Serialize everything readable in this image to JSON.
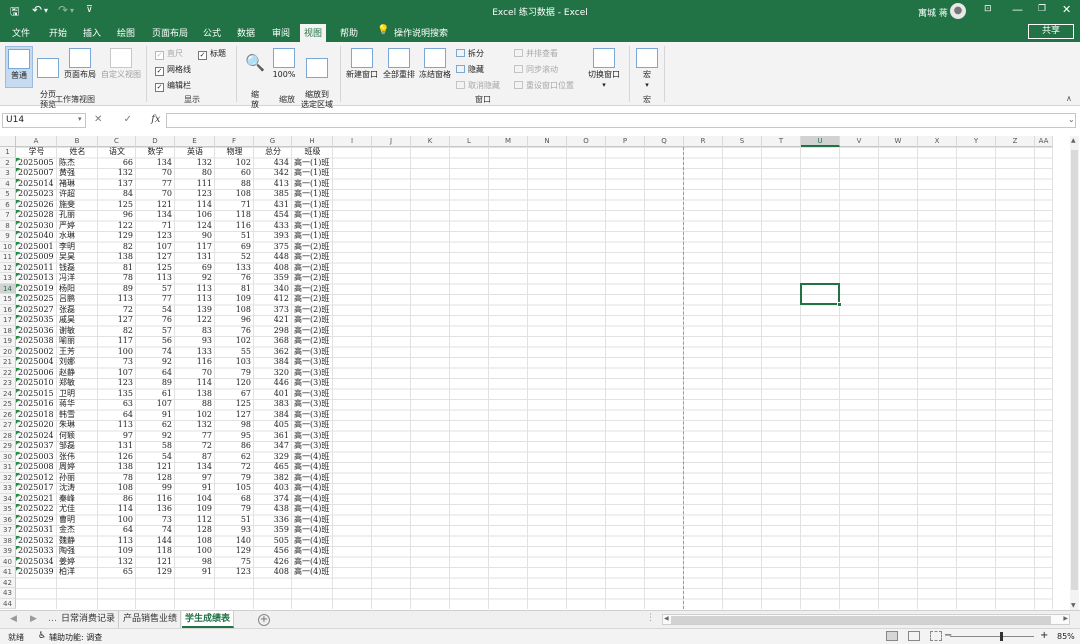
{
  "title_bar": {
    "save_icon": "save-icon",
    "undo_icon": "undo-icon",
    "redo_icon": "redo-icon",
    "customize_icon": "dropdown-icon",
    "doc_title": "Excel 练习数据 - Excel",
    "user_name": "寓城 蒋",
    "avatar_icon": "user-avatar-icon"
  },
  "menu": {
    "tabs": [
      "文件",
      "开始",
      "插入",
      "绘图",
      "页面布局",
      "公式",
      "数据",
      "审阅",
      "视图",
      "帮助",
      "操作说明搜索"
    ],
    "active": "视图",
    "search_icon": "lightbulb-icon",
    "share": "共享"
  },
  "ribbon": {
    "workbook_views": {
      "label": "工作簿视图",
      "normal": "普通",
      "page_break": "分页\n预览",
      "page_layout": "页面布局",
      "custom": "自定义视图"
    },
    "show": {
      "label": "显示",
      "ruler": "直尺",
      "gridlines": "网格线",
      "formula_bar": "编辑栏",
      "headings": "标题"
    },
    "zoom": {
      "label": "缩放",
      "zoom": "缩\n放",
      "100": "100%",
      "zoom_selection": "缩放到\n选定区域"
    },
    "window": {
      "label": "窗口",
      "new_window": "新建窗口",
      "arrange_all": "全部重排",
      "freeze": "冻结窗格",
      "split": "拆分",
      "hide": "隐藏",
      "unhide": "取消隐藏",
      "side_by_side": "并排查看",
      "sync_scroll": "同步滚动",
      "reset_position": "重设窗口位置",
      "switch": "切换窗口"
    },
    "macros": {
      "label": "宏",
      "macros": "宏"
    }
  },
  "formula_bar": {
    "name_box": "U14",
    "cancel": "✕",
    "enter": "✓",
    "fx": "fx",
    "value": ""
  },
  "grid": {
    "columns": [
      "A",
      "B",
      "C",
      "D",
      "E",
      "F",
      "G",
      "H",
      "I",
      "J",
      "K",
      "L",
      "M",
      "N",
      "O",
      "P",
      "Q",
      "R",
      "S",
      "T",
      "U",
      "V",
      "W",
      "X",
      "Y",
      "Z",
      "AA"
    ],
    "selected_col": "U",
    "selected_row": 14,
    "row_numbers": [
      1,
      2,
      3,
      4,
      5,
      6,
      7,
      8,
      9,
      10,
      11,
      12,
      13,
      14,
      15,
      16,
      17,
      18,
      19,
      20,
      21,
      22,
      23,
      24,
      25,
      26,
      27,
      28,
      29,
      30,
      31,
      32,
      33,
      34,
      35,
      36,
      37,
      38,
      39,
      40,
      41,
      42,
      43,
      44
    ],
    "header": [
      "学号",
      "姓名",
      "语文",
      "数学",
      "英语",
      "物理",
      "总分",
      "班级"
    ],
    "rows": [
      [
        "2025005",
        "陈杰",
        "66",
        "134",
        "132",
        "102",
        "434",
        "高一(1)班"
      ],
      [
        "2025007",
        "黄强",
        "132",
        "70",
        "80",
        "60",
        "342",
        "高一(1)班"
      ],
      [
        "2025014",
        "褚琳",
        "137",
        "77",
        "111",
        "88",
        "413",
        "高一(1)班"
      ],
      [
        "2025023",
        "许超",
        "84",
        "70",
        "123",
        "108",
        "385",
        "高一(1)班"
      ],
      [
        "2025026",
        "施斐",
        "125",
        "121",
        "114",
        "71",
        "431",
        "高一(1)班"
      ],
      [
        "2025028",
        "孔丽",
        "96",
        "134",
        "106",
        "118",
        "454",
        "高一(1)班"
      ],
      [
        "2025030",
        "严婷",
        "122",
        "71",
        "124",
        "116",
        "433",
        "高一(1)班"
      ],
      [
        "2025040",
        "水琳",
        "129",
        "123",
        "90",
        "51",
        "393",
        "高一(1)班"
      ],
      [
        "2025001",
        "李明",
        "82",
        "107",
        "117",
        "69",
        "375",
        "高一(2)班"
      ],
      [
        "2025009",
        "吴昊",
        "138",
        "127",
        "131",
        "52",
        "448",
        "高一(2)班"
      ],
      [
        "2025011",
        "钱磊",
        "81",
        "125",
        "69",
        "133",
        "408",
        "高一(2)班"
      ],
      [
        "2025013",
        "冯洋",
        "78",
        "113",
        "92",
        "76",
        "359",
        "高一(2)班"
      ],
      [
        "2025019",
        "杨阳",
        "89",
        "57",
        "113",
        "81",
        "340",
        "高一(2)班"
      ],
      [
        "2025025",
        "吕鹏",
        "113",
        "77",
        "113",
        "109",
        "412",
        "高一(2)班"
      ],
      [
        "2025027",
        "张磊",
        "72",
        "54",
        "139",
        "108",
        "373",
        "高一(2)班"
      ],
      [
        "2025035",
        "戚昊",
        "127",
        "76",
        "122",
        "96",
        "421",
        "高一(2)班"
      ],
      [
        "2025036",
        "谢敏",
        "82",
        "57",
        "83",
        "76",
        "298",
        "高一(2)班"
      ],
      [
        "2025038",
        "喻丽",
        "117",
        "56",
        "93",
        "102",
        "368",
        "高一(2)班"
      ],
      [
        "2025002",
        "王芳",
        "100",
        "74",
        "133",
        "55",
        "362",
        "高一(3)班"
      ],
      [
        "2025004",
        "刘娜",
        "73",
        "92",
        "116",
        "103",
        "384",
        "高一(3)班"
      ],
      [
        "2025006",
        "赵静",
        "107",
        "64",
        "70",
        "79",
        "320",
        "高一(3)班"
      ],
      [
        "2025010",
        "郑敏",
        "123",
        "89",
        "114",
        "120",
        "446",
        "高一(3)班"
      ],
      [
        "2025015",
        "卫明",
        "135",
        "61",
        "138",
        "67",
        "401",
        "高一(3)班"
      ],
      [
        "2025016",
        "蒋华",
        "63",
        "107",
        "88",
        "125",
        "383",
        "高一(3)班"
      ],
      [
        "2025018",
        "韩雪",
        "64",
        "91",
        "102",
        "127",
        "384",
        "高一(3)班"
      ],
      [
        "2025020",
        "朱琳",
        "113",
        "62",
        "132",
        "98",
        "405",
        "高一(3)班"
      ],
      [
        "2025024",
        "何颖",
        "97",
        "92",
        "77",
        "95",
        "361",
        "高一(3)班"
      ],
      [
        "2025037",
        "邹磊",
        "131",
        "58",
        "72",
        "86",
        "347",
        "高一(3)班"
      ],
      [
        "2025003",
        "张伟",
        "126",
        "54",
        "87",
        "62",
        "329",
        "高一(4)班"
      ],
      [
        "2025008",
        "周婷",
        "138",
        "121",
        "134",
        "72",
        "465",
        "高一(4)班"
      ],
      [
        "2025012",
        "孙丽",
        "78",
        "128",
        "97",
        "79",
        "382",
        "高一(4)班"
      ],
      [
        "2025017",
        "沈涛",
        "108",
        "99",
        "91",
        "105",
        "403",
        "高一(4)班"
      ],
      [
        "2025021",
        "秦峰",
        "86",
        "116",
        "104",
        "68",
        "374",
        "高一(4)班"
      ],
      [
        "2025022",
        "尤佳",
        "114",
        "136",
        "109",
        "79",
        "438",
        "高一(4)班"
      ],
      [
        "2025029",
        "曹明",
        "100",
        "73",
        "112",
        "51",
        "336",
        "高一(4)班"
      ],
      [
        "2025031",
        "金杰",
        "64",
        "74",
        "128",
        "93",
        "359",
        "高一(4)班"
      ],
      [
        "2025032",
        "魏静",
        "113",
        "144",
        "108",
        "140",
        "505",
        "高一(4)班"
      ],
      [
        "2025033",
        "陶强",
        "109",
        "118",
        "100",
        "129",
        "456",
        "高一(4)班"
      ],
      [
        "2025034",
        "姜婷",
        "132",
        "121",
        "98",
        "75",
        "426",
        "高一(4)班"
      ],
      [
        "2025039",
        "柏洋",
        "65",
        "129",
        "91",
        "123",
        "408",
        "高一(4)班"
      ]
    ]
  },
  "sheets": {
    "tabs": [
      "日常消费记录",
      "产品销售业绩",
      "学生成绩表"
    ],
    "active": "学生成绩表",
    "add": "+"
  },
  "status": {
    "ready": "就绪",
    "accessibility": "辅助功能: 调查",
    "zoom": "85%",
    "zoom_minus": "−",
    "zoom_plus": "+"
  }
}
